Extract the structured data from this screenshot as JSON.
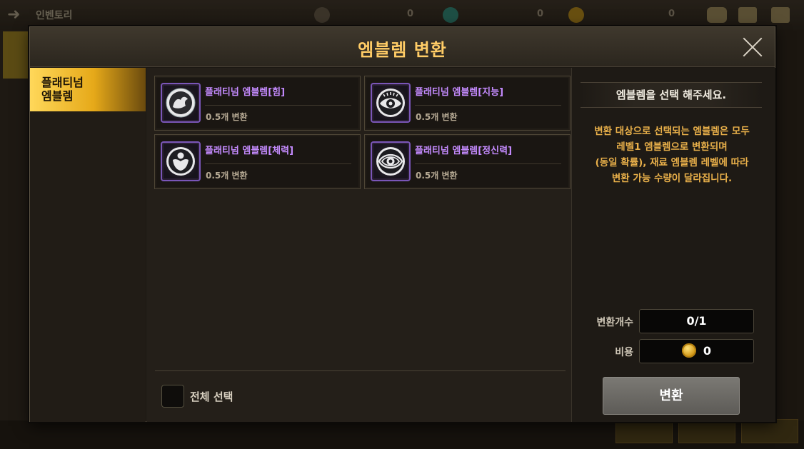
{
  "background": {
    "title": "인벤토리",
    "currency": [
      {
        "icon": "gold-coin-icon",
        "value": "0"
      },
      {
        "icon": "gem-icon",
        "value": "0"
      },
      {
        "icon": "crystal-icon",
        "value": "0"
      }
    ]
  },
  "modal": {
    "title": "엠블렘 변환",
    "close_icon": "close-icon"
  },
  "category": {
    "active_tab": "플래티넘\n엠블렘"
  },
  "emblems": [
    {
      "name": "플래티넘 엠블렘[힘]",
      "rate": "0.5개 변환",
      "icon": "strength-emblem-icon"
    },
    {
      "name": "플래티넘 엠블렘[지능]",
      "rate": "0.5개 변환",
      "icon": "intelligence-emblem-icon"
    },
    {
      "name": "플래티넘 엠블렘[체력]",
      "rate": "0.5개 변환",
      "icon": "vitality-emblem-icon"
    },
    {
      "name": "플래티넘 엠블렘[정신력]",
      "rate": "0.5개 변환",
      "icon": "spirit-emblem-icon"
    }
  ],
  "select_all": {
    "label": "전체 선택",
    "checked": false
  },
  "info": {
    "heading": "엠블렘을 선택 해주세요.",
    "description": "변환 대상으로 선택되는 엠블렘은 모두\n레벨1 엠블렘으로 변환되며\n(동일 확률), 재료 엠블렘 레벨에 따라\n변환 가능 수량이 달라집니다.",
    "count_label": "변환개수",
    "count_value": "0/1",
    "cost_label": "비용",
    "cost_value": "0",
    "convert_button": "변환"
  },
  "colors": {
    "title": "#ffcc66",
    "emblem_name": "#c58bff",
    "description": "#e9b04a",
    "active_tab": "#f0b52a"
  }
}
